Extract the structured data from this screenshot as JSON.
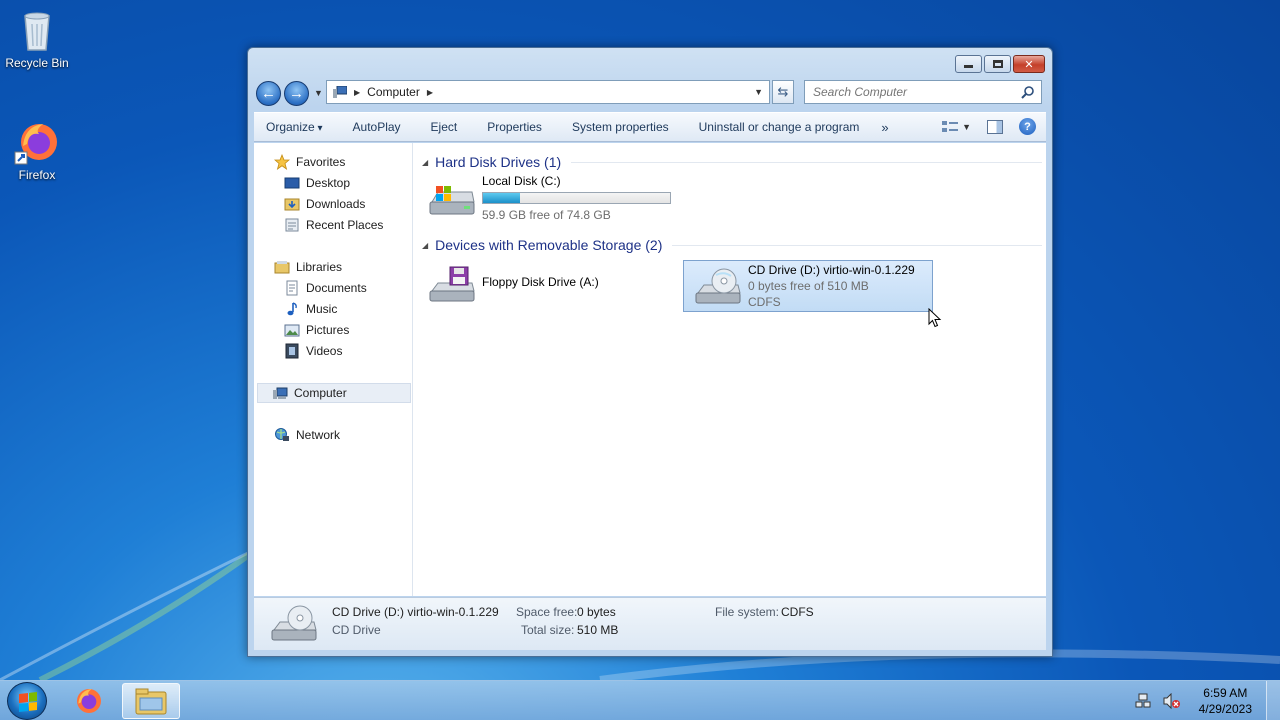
{
  "desktop": {
    "icons": [
      {
        "label": "Recycle Bin",
        "icon": "recycle-bin-icon"
      },
      {
        "label": "Firefox",
        "icon": "firefox-icon"
      }
    ]
  },
  "window": {
    "address": {
      "location": "Computer"
    },
    "search": {
      "placeholder": "Search Computer"
    },
    "toolbar": {
      "organize": "Organize",
      "autoplay": "AutoPlay",
      "eject": "Eject",
      "properties": "Properties",
      "system_properties": "System properties",
      "uninstall": "Uninstall or change a program",
      "more": "»"
    },
    "nav": {
      "favorites": "Favorites",
      "desktop": "Desktop",
      "downloads": "Downloads",
      "recent_places": "Recent Places",
      "libraries": "Libraries",
      "documents": "Documents",
      "music": "Music",
      "pictures": "Pictures",
      "videos": "Videos",
      "computer": "Computer",
      "network": "Network"
    },
    "groups": {
      "hard_disks": "Hard Disk Drives (1)",
      "removable": "Devices with Removable Storage (2)"
    },
    "drives": {
      "c": {
        "name": "Local Disk (C:)",
        "free_text": "59.9 GB free of 74.8 GB",
        "used_fraction": 0.2
      },
      "a": {
        "name": "Floppy Disk Drive (A:)"
      },
      "d": {
        "name": "CD Drive (D:) virtio-win-0.1.229",
        "free_text": "0 bytes free of 510 MB",
        "fs": "CDFS"
      }
    },
    "details": {
      "name": "CD Drive (D:) virtio-win-0.1.229",
      "type": "CD Drive",
      "space_free_label": "Space free:",
      "space_free": "0 bytes",
      "total_size_label": "Total size:",
      "total_size": "510 MB",
      "fs_label": "File system:",
      "fs": "CDFS"
    }
  },
  "taskbar": {
    "time": "6:59 AM",
    "date": "4/29/2023"
  },
  "colors": {
    "accent": "#1e3287",
    "selection": "#c2dcf5",
    "capacity_fill": "#1c90c9"
  }
}
